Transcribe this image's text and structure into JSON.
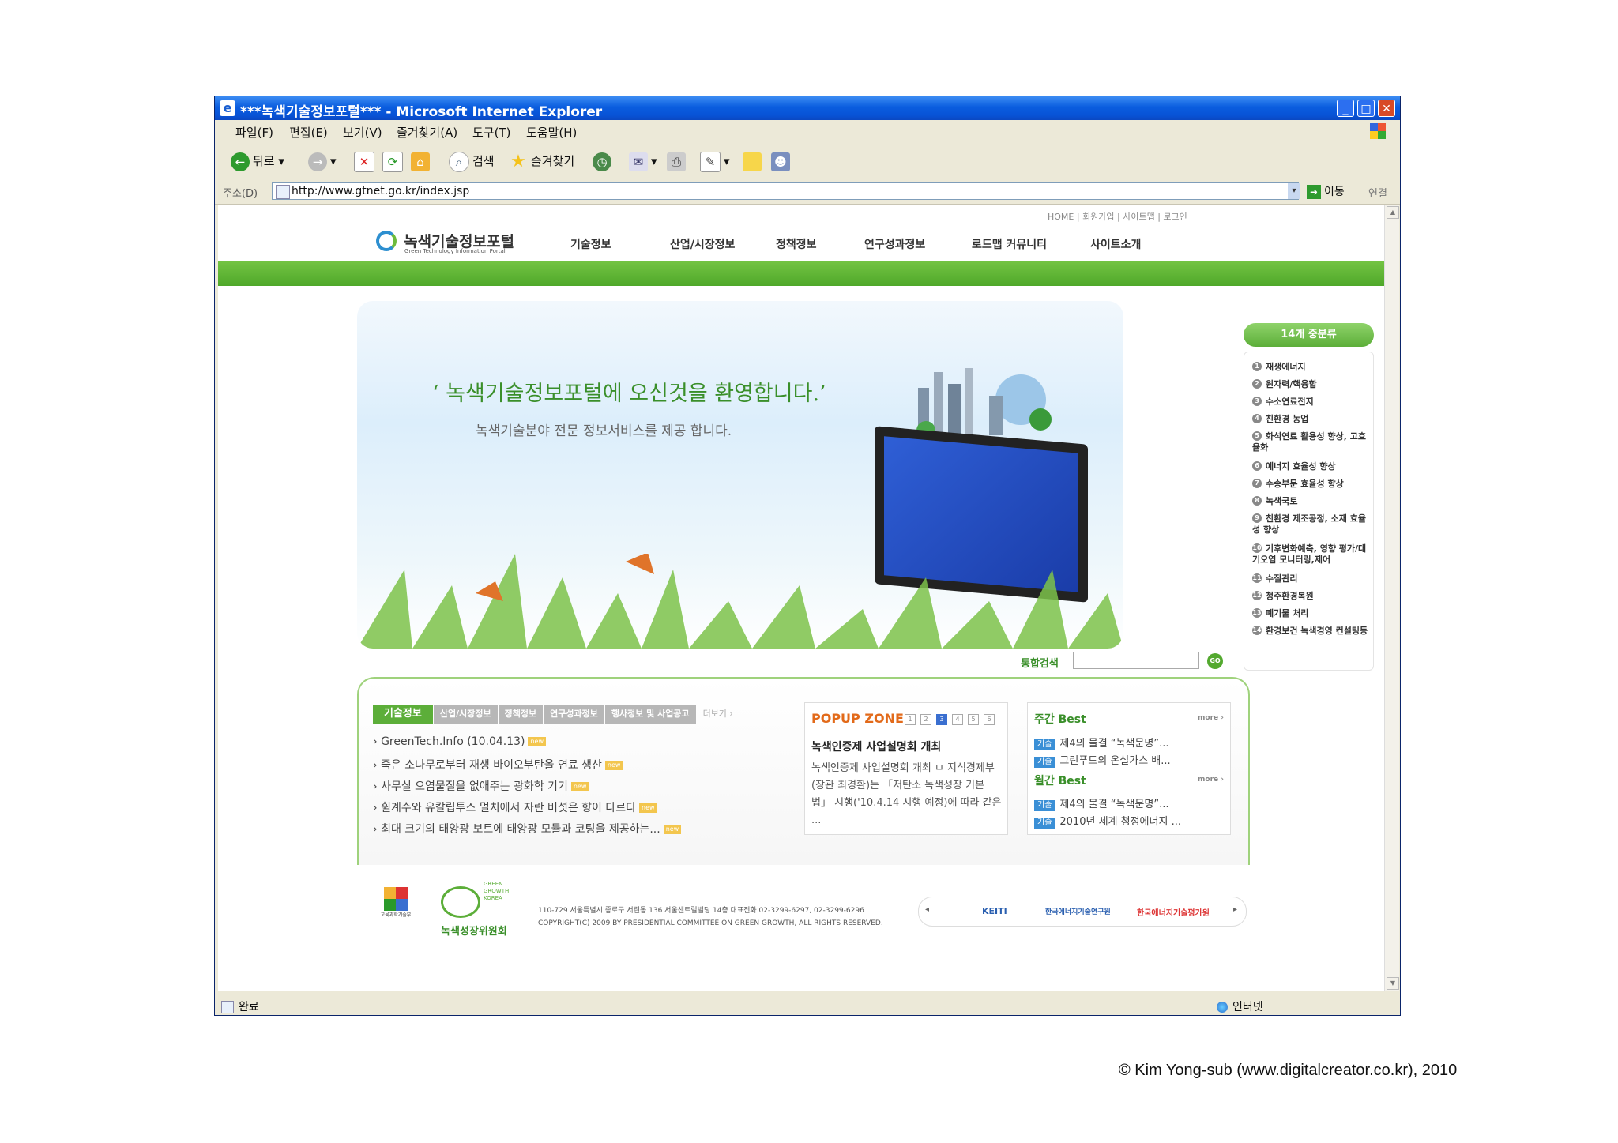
{
  "window": {
    "title": "***녹색기술정보포털*** - Microsoft Internet Explorer"
  },
  "menubar": [
    "파일(F)",
    "편집(E)",
    "보기(V)",
    "즐겨찾기(A)",
    "도구(T)",
    "도움말(H)"
  ],
  "toolbar": {
    "back": "뒤로",
    "search": "검색",
    "favorites": "즐겨찾기"
  },
  "addressbar": {
    "label": "주소(D)",
    "url": "http://www.gtnet.go.kr/index.jsp",
    "go": "이동",
    "links": "연결"
  },
  "status": {
    "left": "완료",
    "zone": "인터넷"
  },
  "site": {
    "toplinks": "HOME  |  회원가입  |  사이트맵  |  로그인",
    "logo_kr": "녹색기술정보포털",
    "logo_en": "Green Technology Information Portal",
    "nav": [
      "기술정보",
      "산업/시장정보",
      "정책정보",
      "연구성과정보",
      "로드맵 커뮤니티",
      "사이트소개"
    ],
    "hero": {
      "welcome": "‘ 녹색기술정보포털에 오신것을 환영합니다.’",
      "subtitle": "녹색기술분야 전문 정보서비스를 제공 합니다."
    },
    "categories": {
      "heading": "14개 중분류",
      "items": [
        "재생에너지",
        "원자력/핵융합",
        "수소연료전지",
        "친환경 농업",
        "화석연료 활용성 향상, 고효율화",
        "에너지 효율성 향상",
        "수송부문 효율성 향상",
        "녹색국토",
        "친환경 제조공정, 소재 효율성 향상",
        "기후변화예측, 영향 평가/대기오염 모니터링,제어",
        "수질관리",
        "청주환경복원",
        "폐기물 처리",
        "환경보건 녹색경영 컨설팅등"
      ]
    },
    "search": {
      "label": "통합검색",
      "go": "GO"
    },
    "tabs": [
      "기술정보",
      "산업/시장정보",
      "정책정보",
      "연구성과정보",
      "행사정보 및 사업공고"
    ],
    "tabs_more": "더보기 ›",
    "news": [
      "GreenTech.Info (10.04.13)",
      "죽은 소나무로부터 재생 바이오부탄올 연료 생산",
      "사무실 오염물질을 없애주는 광화학 기기",
      "휠계수와 유칼립투스 멀치에서 자란 버섯은 향이 다르다",
      "최대 크기의 태양광 보트에 태양광 모듈과 코팅을 제공하는..."
    ],
    "new_badge": "new",
    "popup": {
      "heading": "POPUP ZONE",
      "pages": [
        "1",
        "2",
        "3",
        "4",
        "5",
        "6"
      ],
      "title": "녹색인증제 사업설명회 개최",
      "body": "녹색인증제 사업설명회 개최 ㅁ 지식경제부(장관 최경환)는 「저탄소 녹색성장 기본법」 시행('10.4.14 시행 예정)에 따라 같은 ..."
    },
    "weekly_best": {
      "heading": "주간 Best",
      "more": "more ›",
      "items": [
        "제4의 물결 “녹색문명”...",
        "그린푸드의 온실가스 배..."
      ]
    },
    "monthly_best": {
      "heading": "월간 Best",
      "more": "more ›",
      "items": [
        "제4의 물결 “녹색문명”...",
        "2010년 세계 청정에너지 ..."
      ]
    },
    "tag_label": "기술",
    "footer": {
      "ministry": "교육과학기술부",
      "gg_en": "GREEN GROWTH KOREA",
      "committee": "녹색성장위원회",
      "address": "110-729 서울특별시 종로구 서린동 136 서울센트럴빌딩 14층 대표전화 02-3299-6297, 02-3299-6296",
      "copyright": "COPYRIGHT(C) 2009 BY PRESIDENTIAL COMMITTEE ON GREEN GROWTH, ALL RIGHTS RESERVED.",
      "partners": [
        "KEITI",
        "한국에너지기술연구원",
        "한국에너지기술평가원"
      ]
    }
  },
  "credit": "© Kim Yong-sub (www.digitalcreator.co.kr), 2010",
  "colors": {
    "accent_green": "#5cae39",
    "ie_blue": "#0a5ddf",
    "popup_orange": "#e26a1a"
  }
}
